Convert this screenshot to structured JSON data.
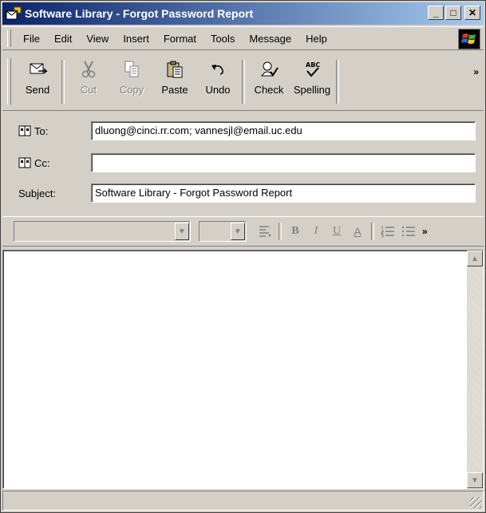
{
  "window": {
    "title": "Software Library  -  Forgot Password Report",
    "minimize": "_",
    "maximize": "□",
    "close": "✕"
  },
  "menu": {
    "file": "File",
    "edit": "Edit",
    "view": "View",
    "insert": "Insert",
    "format": "Format",
    "tools": "Tools",
    "message": "Message",
    "help": "Help"
  },
  "toolbar": {
    "send": "Send",
    "cut": "Cut",
    "copy": "Copy",
    "paste": "Paste",
    "undo": "Undo",
    "check": "Check",
    "spelling": "Spelling",
    "more": "»"
  },
  "fields": {
    "to_label": "To:",
    "to_value": "dluong@cinci.rr.com; vannesjl@email.uc.edu",
    "cc_label": "Cc:",
    "cc_value": "",
    "subject_label": "Subject:",
    "subject_value": "Software Library  -  Forgot Password Report"
  },
  "formatbar": {
    "bold": "B",
    "italic": "I",
    "underline": "U",
    "font_color": "A",
    "more": "»"
  },
  "icons": {
    "send": "send-icon",
    "cut": "scissors-icon",
    "copy": "copy-icon",
    "paste": "paste-icon",
    "undo": "undo-icon",
    "check": "check-names-icon",
    "spelling": "spelling-icon"
  },
  "colors": {
    "title_start": "#0a246a",
    "title_end": "#a6caf0",
    "face": "#d4d0c8"
  }
}
